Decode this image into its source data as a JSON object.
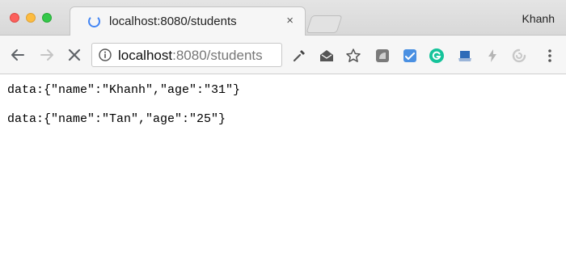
{
  "window": {
    "profile_name": "Khanh"
  },
  "tab": {
    "title": "localhost:8080/students",
    "close_glyph": "×"
  },
  "address_bar": {
    "host": "localhost",
    "rest": ":8080/students"
  },
  "toolbar": {
    "icons": [
      "back-arrow-icon",
      "forward-arrow-icon",
      "stop-icon",
      "info-icon",
      "eyedropper-icon",
      "envelope-icon",
      "star-icon",
      "grey-extension-icon",
      "blue-check-extension-icon",
      "grammarly-icon",
      "tray-icon",
      "bolt-icon",
      "spinner-extension-icon",
      "menu-icon"
    ],
    "accent_colors": {
      "spinner": "#4285f4",
      "grammarly": "#15c39a",
      "blue_extension": "#4a90e2"
    }
  },
  "content": {
    "lines": [
      "data:{\"name\":\"Khanh\",\"age\":\"31\"}",
      "data:{\"name\":\"Tan\",\"age\":\"25\"}"
    ]
  }
}
